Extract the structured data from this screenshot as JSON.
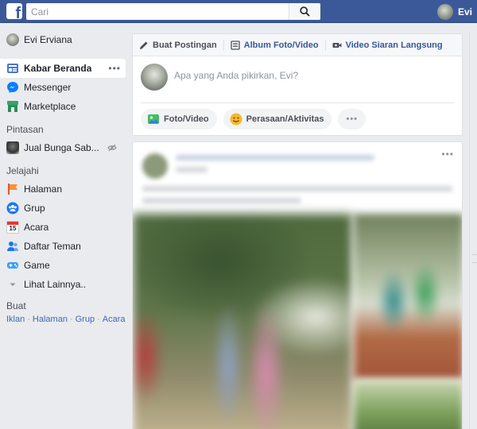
{
  "topbar": {
    "logo_letter": "f",
    "search_placeholder": "Cari",
    "user_name": "Evi"
  },
  "leftnav": {
    "profile_name": "Evi Erviana",
    "main_items": [
      {
        "label": "Kabar Beranda",
        "icon": "news-feed-icon",
        "active": true
      },
      {
        "label": "Messenger",
        "icon": "messenger-icon"
      },
      {
        "label": "Marketplace",
        "icon": "marketplace-icon"
      }
    ],
    "more_dots": "•••",
    "shortcuts_title": "Pintasan",
    "shortcuts": [
      {
        "label": "Jual Bunga Sab...",
        "icon": "group-photo-icon"
      }
    ],
    "explore_title": "Jelajahi",
    "explore_items": [
      {
        "label": "Halaman",
        "icon": "flag-icon"
      },
      {
        "label": "Grup",
        "icon": "groups-icon"
      },
      {
        "label": "Acara",
        "icon": "calendar-icon",
        "day": "15"
      },
      {
        "label": "Daftar Teman",
        "icon": "friend-list-icon"
      },
      {
        "label": "Game",
        "icon": "gamepad-icon"
      }
    ],
    "see_more": "Lihat Lainnya..",
    "create_title": "Buat",
    "create_links": [
      "Iklan",
      "Halaman",
      "Grup",
      "Acara"
    ],
    "create_separator": "·"
  },
  "composer": {
    "tabs": [
      {
        "label": "Buat Postingan",
        "icon": "pencil-icon"
      },
      {
        "label": "Album Foto/Video",
        "icon": "album-icon"
      },
      {
        "label": "Video Siaran Langsung",
        "icon": "live-video-icon"
      }
    ],
    "placeholder": "Apa yang Anda pikirkan, Evi?",
    "actions": [
      {
        "label": "Foto/Video",
        "icon": "photo-icon"
      },
      {
        "label": "Perasaan/Aktivitas",
        "icon": "smiley-icon"
      }
    ],
    "more_dots": "•••"
  },
  "post": {
    "more_dots": "•••"
  },
  "colors": {
    "brand_blue": "#3b5998",
    "link_blue": "#365899",
    "page_bg": "#e9ebee"
  }
}
